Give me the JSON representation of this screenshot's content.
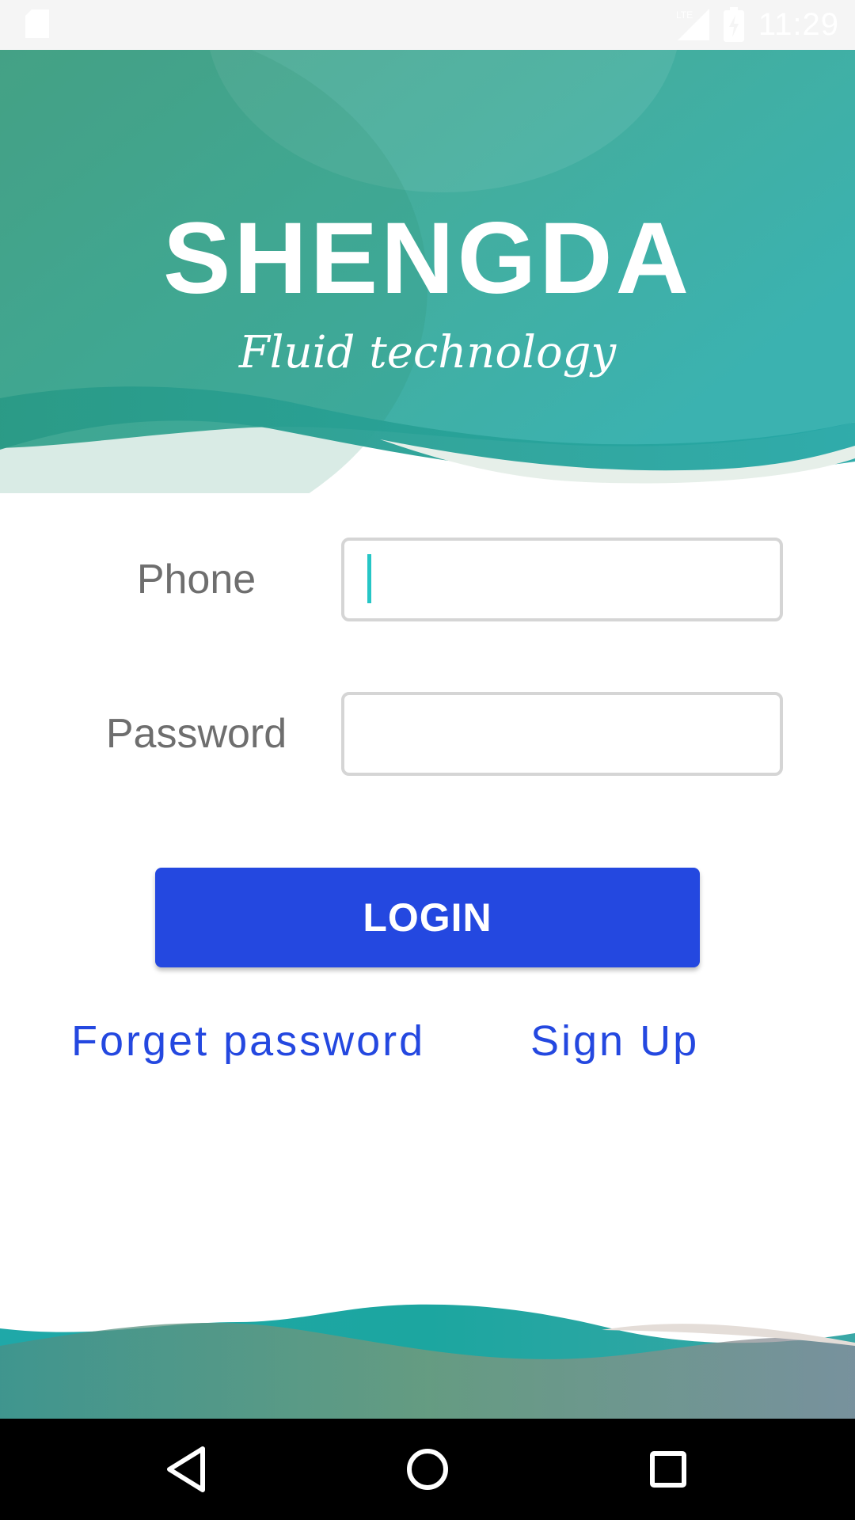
{
  "status_bar": {
    "time": "11:29",
    "network_label": "LTE",
    "icons": [
      "sd-card-icon",
      "lte-signal-icon",
      "battery-charging-icon"
    ]
  },
  "header": {
    "brand": "SHENGDA",
    "tagline": "Fluid technology",
    "colors": {
      "teal": "#3fb0a8",
      "teal_dark": "#1aa3a0",
      "green": "#4a9a78"
    }
  },
  "form": {
    "phone_label": "Phone",
    "phone_value": "",
    "password_label": "Password",
    "password_value": ""
  },
  "actions": {
    "login_label": "LOGIN",
    "forget_password_label": "Forget password",
    "sign_up_label": "Sign Up",
    "accent_color": "#2448e0"
  },
  "nav_bar": {
    "icons": [
      "back-triangle-icon",
      "home-circle-icon",
      "recents-square-icon"
    ]
  }
}
